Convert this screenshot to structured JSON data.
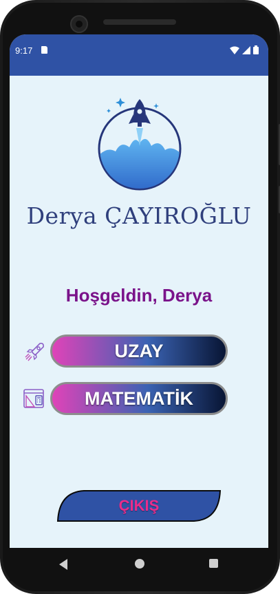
{
  "status_bar": {
    "time": "9:17",
    "background": "#2f52a5"
  },
  "brand": {
    "name": "Derya ÇAYIROĞLU",
    "logo_icon": "rocket-launch-logo"
  },
  "welcome": {
    "text": "Hoşgeldin,  Derya",
    "color": "#7a138a"
  },
  "menu": [
    {
      "label": "UZAY",
      "icon": "rocket-icon"
    },
    {
      "label": "MATEMATİK",
      "icon": "math-tools-icon"
    }
  ],
  "exit": {
    "label": "ÇIKIŞ",
    "color": "#ea2c8a"
  },
  "colors": {
    "screen_bg": "#e6f3fa",
    "button_start": "#e043b8",
    "button_end": "#081534",
    "exit_bg": "#2f52a5"
  }
}
